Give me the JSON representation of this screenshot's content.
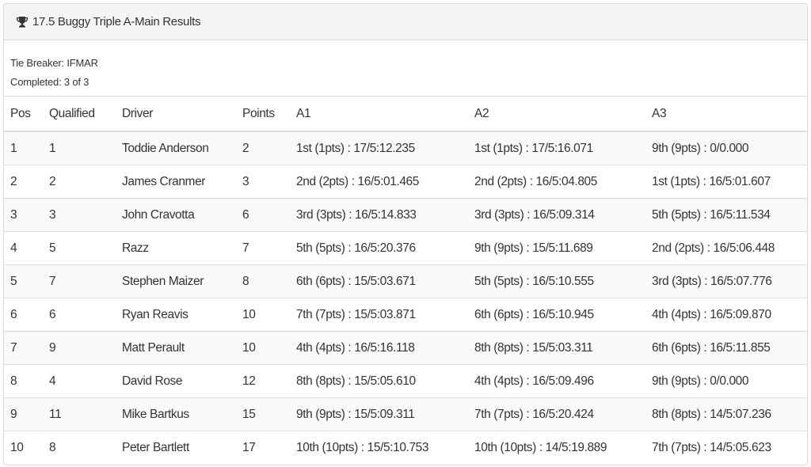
{
  "panel": {
    "title": "17.5 Buggy Triple A-Main Results",
    "title_icon": "trophy-icon"
  },
  "meta": {
    "tie_breaker": "Tie Breaker: IFMAR",
    "completed": "Completed: 3 of 3"
  },
  "table": {
    "headers": [
      "Pos",
      "Qualified",
      "Driver",
      "Points",
      "A1",
      "A2",
      "A3"
    ],
    "rows": [
      {
        "pos": "1",
        "qualified": "1",
        "driver": "Toddie Anderson",
        "points": "2",
        "a1": "1st (1pts) : 17/5:12.235",
        "a2": "1st (1pts) : 17/5:16.071",
        "a3": "9th (9pts) : 0/0.000"
      },
      {
        "pos": "2",
        "qualified": "2",
        "driver": "James Cranmer",
        "points": "3",
        "a1": "2nd (2pts) : 16/5:01.465",
        "a2": "2nd (2pts) : 16/5:04.805",
        "a3": "1st (1pts) : 16/5:01.607"
      },
      {
        "pos": "3",
        "qualified": "3",
        "driver": "John Cravotta",
        "points": "6",
        "a1": "3rd (3pts) : 16/5:14.833",
        "a2": "3rd (3pts) : 16/5:09.314",
        "a3": "5th (5pts) : 16/5:11.534"
      },
      {
        "pos": "4",
        "qualified": "5",
        "driver": "Razz",
        "points": "7",
        "a1": "5th (5pts) : 16/5:20.376",
        "a2": "9th (9pts) : 15/5:11.689",
        "a3": "2nd (2pts) : 16/5:06.448"
      },
      {
        "pos": "5",
        "qualified": "7",
        "driver": "Stephen Maizer",
        "points": "8",
        "a1": "6th (6pts) : 15/5:03.671",
        "a2": "5th (5pts) : 16/5:10.555",
        "a3": "3rd (3pts) : 16/5:07.776"
      },
      {
        "pos": "6",
        "qualified": "6",
        "driver": "Ryan Reavis",
        "points": "10",
        "a1": "7th (7pts) : 15/5:03.871",
        "a2": "6th (6pts) : 16/5:10.945",
        "a3": "4th (4pts) : 16/5:09.870"
      },
      {
        "pos": "7",
        "qualified": "9",
        "driver": "Matt Perault",
        "points": "10",
        "a1": "4th (4pts) : 16/5:16.118",
        "a2": "8th (8pts) : 15/5:03.311",
        "a3": "6th (6pts) : 16/5:11.855"
      },
      {
        "pos": "8",
        "qualified": "4",
        "driver": "David Rose",
        "points": "12",
        "a1": "8th (8pts) : 15/5:05.610",
        "a2": "4th (4pts) : 16/5:09.496",
        "a3": "9th (9pts) : 0/0.000"
      },
      {
        "pos": "9",
        "qualified": "11",
        "driver": "Mike Bartkus",
        "points": "15",
        "a1": "9th (9pts) : 15/5:09.311",
        "a2": "7th (7pts) : 16/5:20.424",
        "a3": "8th (8pts) : 14/5:07.236"
      },
      {
        "pos": "10",
        "qualified": "8",
        "driver": "Peter Bartlett",
        "points": "17",
        "a1": "10th (10pts) : 15/5:10.753",
        "a2": "10th (10pts) : 14/5:19.889",
        "a3": "7th (7pts) : 14/5:05.623"
      }
    ]
  }
}
